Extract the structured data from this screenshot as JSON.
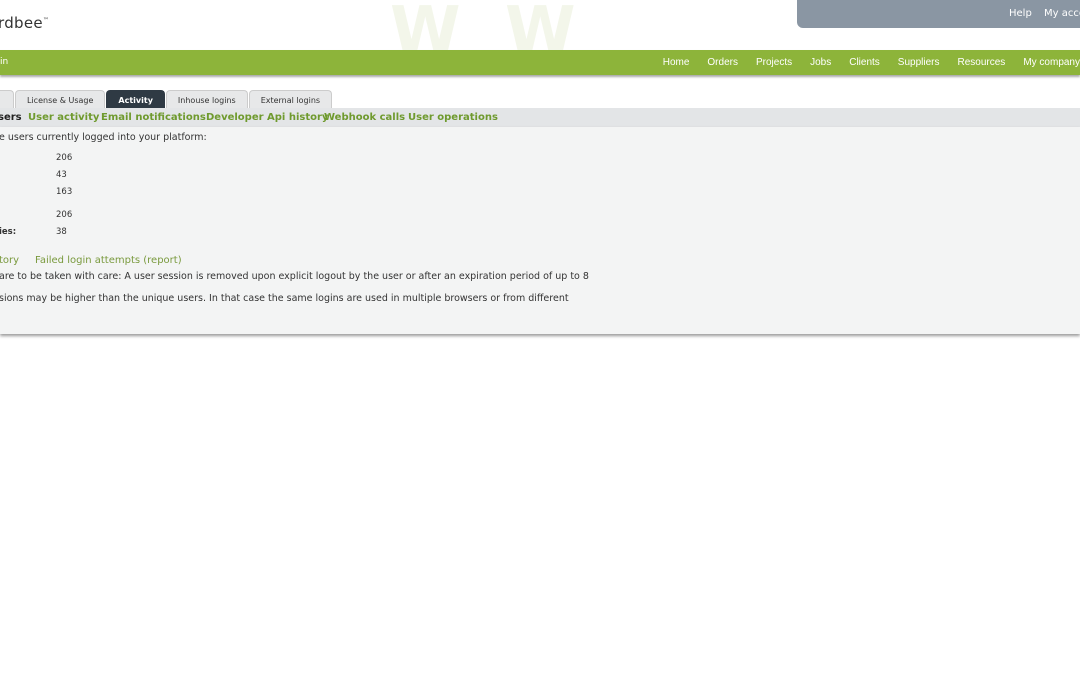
{
  "logo": {
    "text": "rdbee",
    "tm": "™"
  },
  "account": {
    "help": "Help",
    "my_account": "My acco"
  },
  "green_bar": {
    "left_text": "in",
    "nav": [
      "Home",
      "Orders",
      "Projects",
      "Jobs",
      "Clients",
      "Suppliers",
      "Resources",
      "My company"
    ]
  },
  "tabs": [
    {
      "label": ""
    },
    {
      "label": "License & Usage"
    },
    {
      "label": "Activity",
      "active": true
    },
    {
      "label": "Inhouse logins"
    },
    {
      "label": "External logins"
    }
  ],
  "subnav": [
    "sers",
    "User activity",
    "Email notifications",
    "Developer Api history",
    "Webhook calls",
    "User operations"
  ],
  "content": {
    "intro": "e users currently logged into your platform:",
    "stats": [
      {
        "label": "",
        "value": "206"
      },
      {
        "label": "",
        "value": "43"
      },
      {
        "label": "",
        "value": "163"
      },
      {
        "label": "",
        "value": "206"
      },
      {
        "label": "ies:",
        "value": "38"
      }
    ],
    "links": [
      "tory",
      "Failed login attempts (report)"
    ],
    "note1": "are to be taken with care: A user session is removed upon explicit logout by the user or after an expiration period of up to 8",
    "note2": "sions may be higher than the unique users. In that case the same logins are used in multiple browsers or from different"
  }
}
